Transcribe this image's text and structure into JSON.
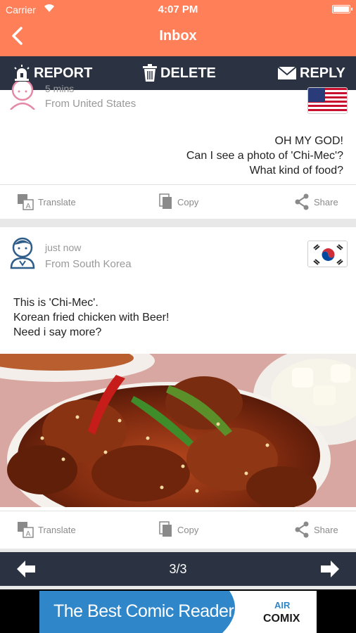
{
  "status_bar": {
    "carrier": "Carrier",
    "time": "4:07 PM"
  },
  "navbar": {
    "title": "Inbox"
  },
  "actions": {
    "report": "REPORT",
    "delete": "DELETE",
    "reply": "REPLY"
  },
  "messages": [
    {
      "time": "5 mins",
      "from": "From United States",
      "flag": "us-flag",
      "lines": [
        "OH MY GOD!",
        "Can I see a photo of 'Chi-Mec'?",
        "What kind of food?"
      ]
    },
    {
      "time": "just now",
      "from": "From South Korea",
      "flag": "kr-flag",
      "lines": [
        "This is 'Chi-Mec'.",
        "Korean fried chicken with Beer!",
        "Need i say more?"
      ]
    }
  ],
  "tools": {
    "translate": "Translate",
    "copy": "Copy",
    "share": "Share"
  },
  "pager": {
    "current": "3/3"
  },
  "ad": {
    "text": "The Best Comic Reader",
    "logo_top": "AIR",
    "logo": "COMIX"
  },
  "colors": {
    "accent": "#ff7f59",
    "bar": "#2b3343",
    "ad_blue": "#2f86c8"
  }
}
